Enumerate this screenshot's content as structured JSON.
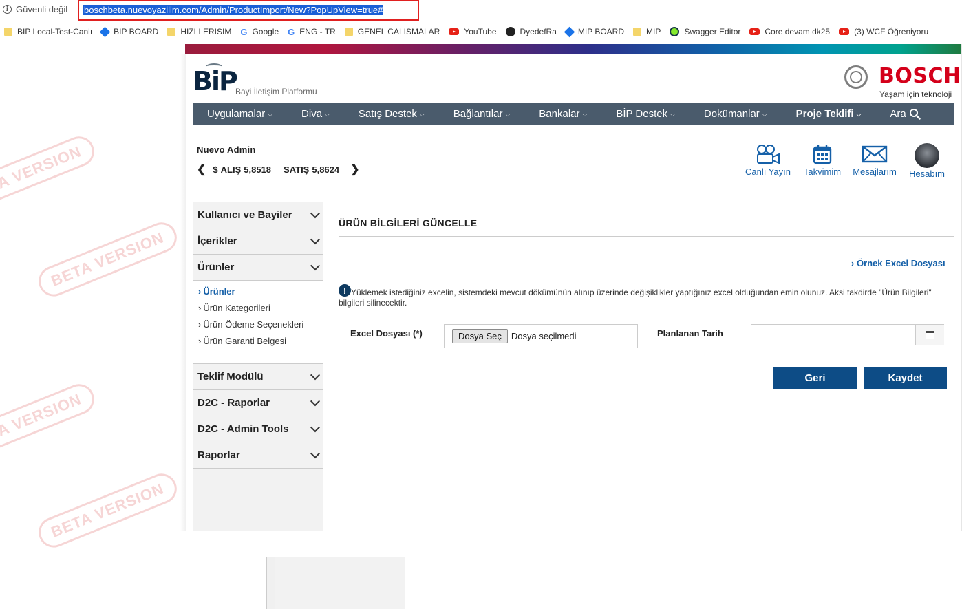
{
  "browser": {
    "security_label": "Güvenli değil",
    "url": "boschbeta.nuevoyazilim.com/Admin/ProductImport/New?PopUpView=true#",
    "bookmarks": [
      {
        "label": "BIP Local-Test-Canlı",
        "icon": "folder-icon"
      },
      {
        "label": "BIP BOARD",
        "icon": "diamond-icon"
      },
      {
        "label": "HIZLI ERISIM",
        "icon": "folder-icon"
      },
      {
        "label": "Google",
        "icon": "google-icon"
      },
      {
        "label": "ENG - TR",
        "icon": "google-icon"
      },
      {
        "label": "GENEL CALISMALAR",
        "icon": "folder-icon"
      },
      {
        "label": "YouTube",
        "icon": "youtube-icon"
      },
      {
        "label": "DyedefRa",
        "icon": "github-icon"
      },
      {
        "label": "MIP BOARD",
        "icon": "diamond-icon"
      },
      {
        "label": "MIP",
        "icon": "folder-icon"
      },
      {
        "label": "Swagger Editor",
        "icon": "swagger-icon"
      },
      {
        "label": "Core devam dk25",
        "icon": "youtube-icon"
      },
      {
        "label": "(3) WCF Öğreniyoru",
        "icon": "youtube-icon"
      }
    ]
  },
  "header": {
    "logo_text": "BiP",
    "logo_subtitle": "Bayi İletişim Platformu",
    "brand_name": "BOSCH",
    "brand_tagline": "Yaşam için teknoloji"
  },
  "nav": {
    "items": [
      "Uygulamalar",
      "Diva",
      "Satış Destek",
      "Bağlantılar",
      "Bankalar",
      "BİP Destek",
      "Dokümanlar",
      "Proje Teklifi",
      "Ara"
    ]
  },
  "user": {
    "name": "Nuevo Admin",
    "currency_symbol": "$",
    "buy_label": "ALIŞ",
    "buy_rate": "5,8518",
    "sell_label": "SATIŞ",
    "sell_rate": "5,8624"
  },
  "quick_actions": {
    "live": "Canlı Yayın",
    "calendar": "Takvimim",
    "messages": "Mesajlarım",
    "account": "Hesabım"
  },
  "sidebar": {
    "sections": [
      "Kullanıcı ve Bayiler",
      "İçerikler",
      "Ürünler",
      "Teklif Modülü",
      "D2C - Raporlar",
      "D2C - Admin Tools",
      "Raporlar"
    ],
    "products_sub": [
      "Ürünler",
      "Ürün Kategorileri",
      "Ürün Ödeme Seçenekleri",
      "Ürün Garanti Belgesi"
    ]
  },
  "content": {
    "title": "ÜRÜN BİLGİLERİ GÜNCELLE",
    "example_link": "Örnek Excel Dosyası",
    "warning": "Yüklemek istediğiniz excelin, sistemdeki mevcut dökümünün alınıp üzerinde değişiklikler yaptığınız excel olduğundan emin olunuz. Aksi takdirde \"Ürün Bilgileri\" bilgileri silinecektir.",
    "excel_label": "Excel Dosyası (*)",
    "file_button": "Dosya Seç",
    "file_status": "Dosya seçilmedi",
    "date_label": "Planlanan Tarih",
    "date_value": "",
    "back_button": "Geri",
    "save_button": "Kaydet"
  },
  "watermark": "BETA VERSION",
  "colors": {
    "nav_bg": "#4a5b6c",
    "primary_button": "#0d4c86",
    "link": "#1560a8",
    "bosch_red": "#d4001a",
    "url_highlight_border": "#e02020"
  }
}
